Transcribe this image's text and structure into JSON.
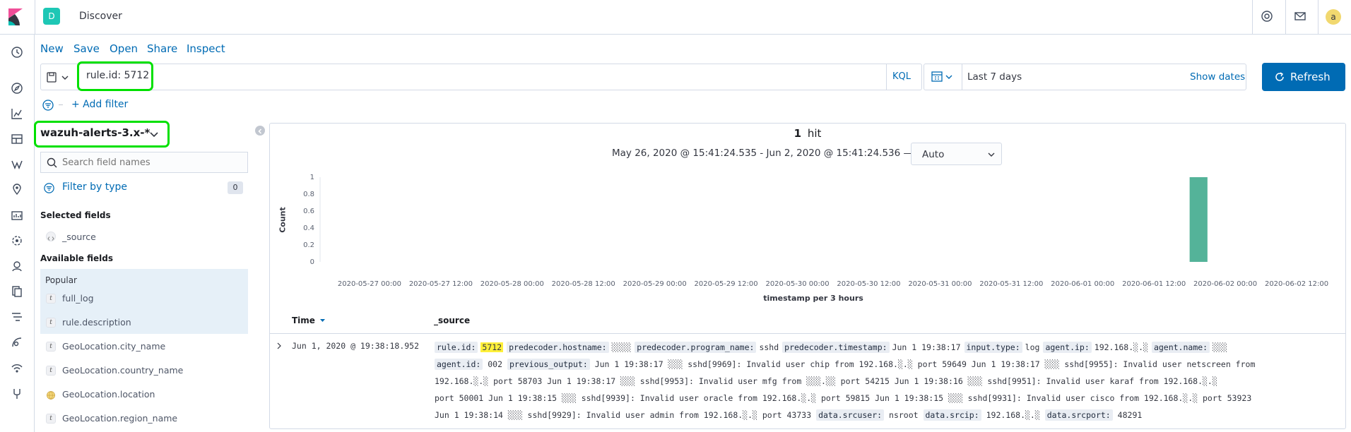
{
  "header": {
    "app_badge": "D",
    "title": "Discover",
    "avatar": "a"
  },
  "menu": {
    "new": "New",
    "save": "Save",
    "open": "Open",
    "share": "Share",
    "inspect": "Inspect"
  },
  "query": {
    "value": "rule.id: 5712",
    "language": "KQL"
  },
  "time": {
    "range": "Last 7 days",
    "show_dates": "Show dates",
    "refresh": "Refresh"
  },
  "filter": {
    "add": "+ Add filter"
  },
  "sidebar": {
    "index_pattern": "wazuh-alerts-3.x-*",
    "search_placeholder": "Search field names",
    "filter_by_type": "Filter by type",
    "filter_count": "0",
    "selected_heading": "Selected fields",
    "selected": [
      {
        "type": "</>",
        "name": "_source"
      }
    ],
    "available_heading": "Available fields",
    "popular_heading": "Popular",
    "popular": [
      {
        "type": "t",
        "name": "full_log"
      },
      {
        "type": "t",
        "name": "rule.description"
      }
    ],
    "fields": [
      {
        "type": "t",
        "name": "GeoLocation.city_name"
      },
      {
        "type": "t",
        "name": "GeoLocation.country_name"
      },
      {
        "type": "geo",
        "name": "GeoLocation.location"
      },
      {
        "type": "t",
        "name": "GeoLocation.region_name"
      }
    ]
  },
  "hits": {
    "count": "1",
    "label": "hit",
    "range": "May 26, 2020 @ 15:41:24.535 - Jun 2, 2020 @ 15:41:24.536 —",
    "interval": "Auto"
  },
  "chart_data": {
    "type": "bar",
    "ylabel": "Count",
    "xlabel": "timestamp per 3 hours",
    "ylim": [
      0,
      1
    ],
    "yticks": [
      "0",
      "0.2",
      "0.4",
      "0.6",
      "0.8",
      "1"
    ],
    "xticks": [
      "2020-05-27 00:00",
      "2020-05-27 12:00",
      "2020-05-28 00:00",
      "2020-05-28 12:00",
      "2020-05-29 00:00",
      "2020-05-29 12:00",
      "2020-05-30 00:00",
      "2020-05-30 12:00",
      "2020-05-31 00:00",
      "2020-05-31 12:00",
      "2020-06-01 00:00",
      "2020-06-01 12:00",
      "2020-06-02 00:00",
      "2020-06-02 12:00"
    ],
    "x_start": "2020-05-26 15:41",
    "x_end": "2020-06-02 15:41",
    "bars": [
      {
        "x": "2020-06-01 18:00",
        "value": 1
      }
    ],
    "color": "#54b399"
  },
  "table": {
    "time_header": "Time",
    "source_header": "_source",
    "row": {
      "time": "Jun 1, 2020 @ 19:38:18.952",
      "line1": [
        {
          "k": "rule.id:",
          "v": "5712",
          "mark": true
        },
        {
          "k": "predecoder.hostname:",
          "v": "░░░░"
        },
        {
          "k": "predecoder.program_name:",
          "v": "sshd"
        },
        {
          "k": "predecoder.timestamp:",
          "v": "Jun 1 19:38:17"
        },
        {
          "k": "input.type:",
          "v": "log"
        },
        {
          "k": "agent.ip:",
          "v": "192.168.░.░"
        },
        {
          "k": "agent.name:",
          "v": "░░░"
        }
      ],
      "line2_key1": "agent.id:",
      "line2_val1": "002",
      "line2_key2": "previous_output:",
      "line2_val2": "Jun 1 19:38:17 ░░░ sshd[9969]: Invalid user chip from 192.168.░.░ port 59649 Jun 1 19:38:17 ░░░ sshd[9955]: Invalid user netscreen from",
      "line3": "192.168.░.░ port 58703 Jun 1 19:38:17 ░░░ sshd[9953]: Invalid user mfg from ░░░.░░ port 54215 Jun 1 19:38:16 ░░░ sshd[9951]: Invalid user karaf from 192.168.░.░",
      "line4": "port 50001 Jun 1 19:38:15 ░░░ sshd[9939]: Invalid user oracle from 192.168.░.░ port 59815 Jun 1 19:38:15 ░░░ sshd[9931]: Invalid user cisco from 192.168.░.░ port 53923",
      "line5_text": "Jun 1 19:38:14 ░░░ sshd[9929]: Invalid user admin from 192.168.░.░ port 43733",
      "line5_k1": "data.srcuser:",
      "line5_v1": "nsroot",
      "line5_k2": "data.srcip:",
      "line5_v2": "192.168.░.░",
      "line5_k3": "data.srcport:",
      "line5_v3": "48291"
    }
  }
}
